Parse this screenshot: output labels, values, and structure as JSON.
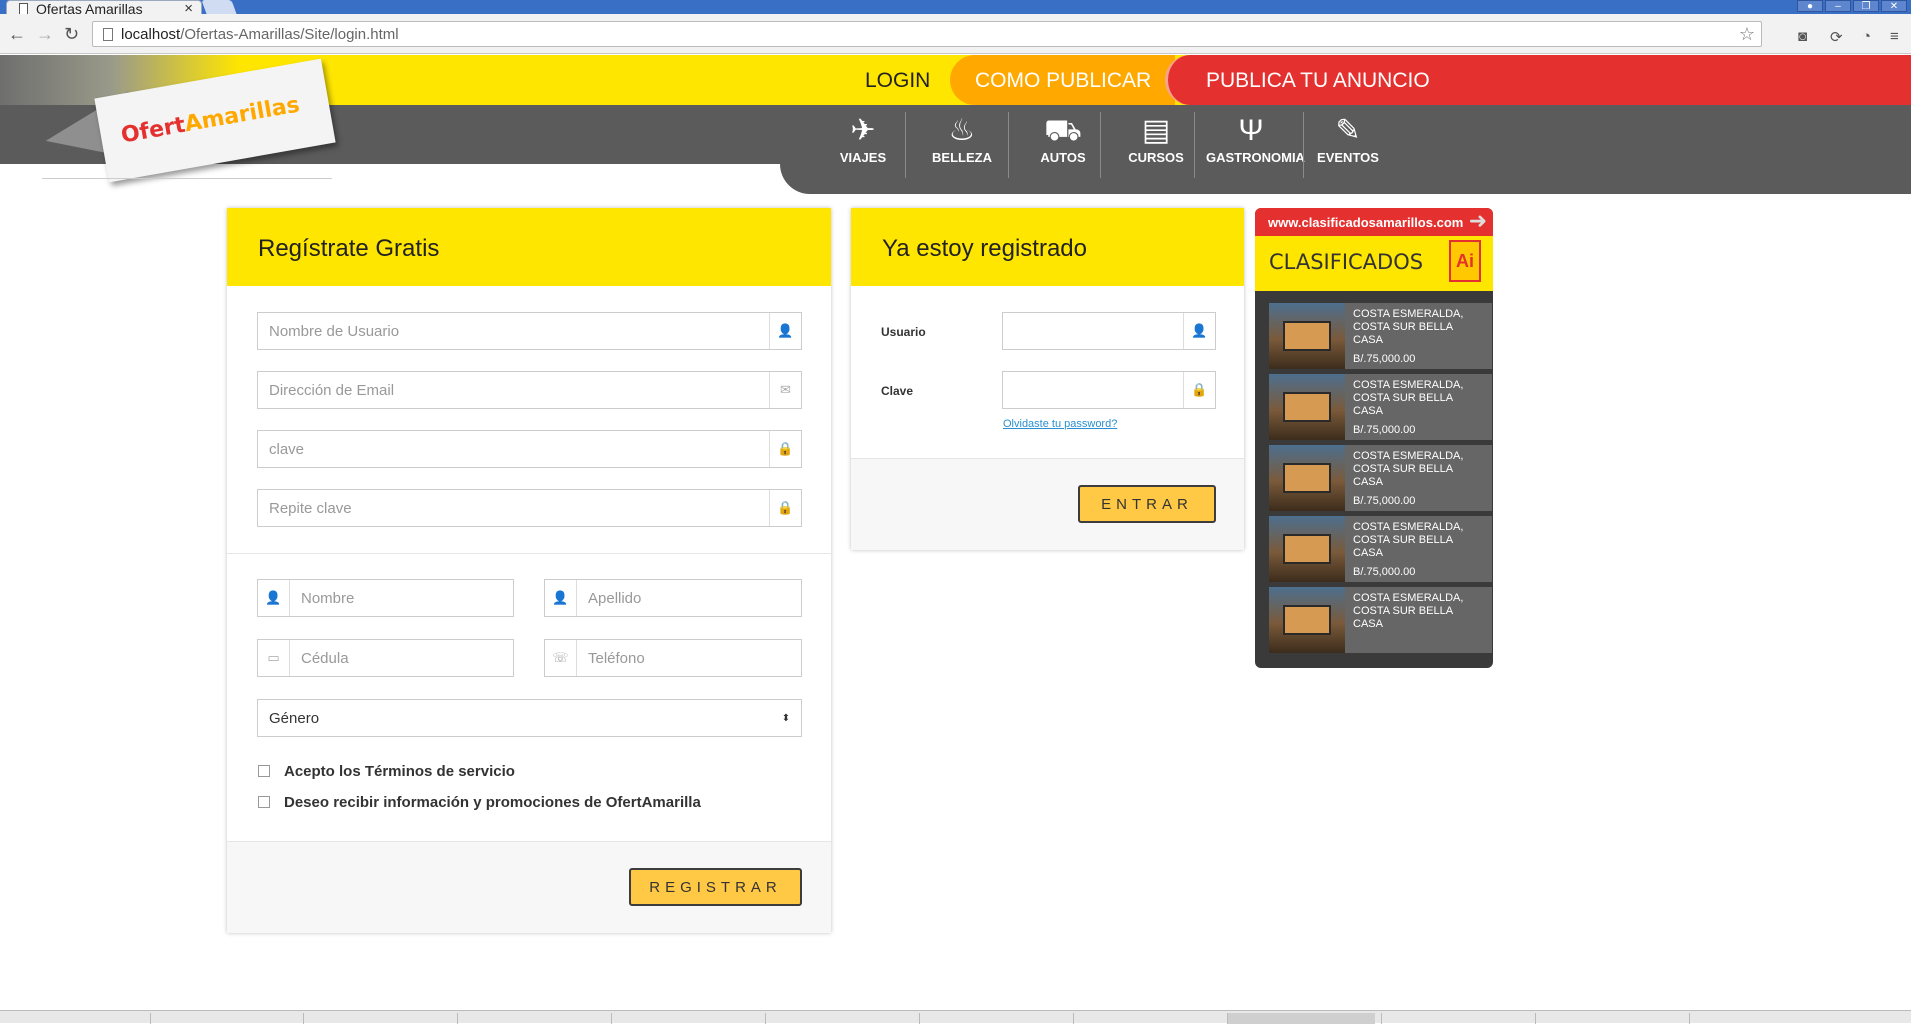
{
  "browser": {
    "tab_title": "Ofertas Amarillas",
    "url_host": "localhost",
    "url_path": "/Ofertas-Amarillas/Site/login.html"
  },
  "header": {
    "logo_text_a": "Ofert",
    "logo_text_b": "Amarillas",
    "menu": [
      "LOGIN",
      "COMO PUBLICAR",
      "PUBLICA TU ANUNCIO"
    ],
    "categories": [
      {
        "label": "VIAJES",
        "icon": "airplane-icon"
      },
      {
        "label": "BELLEZA",
        "icon": "hairdryer-icon"
      },
      {
        "label": "AUTOS",
        "icon": "car-icon"
      },
      {
        "label": "CURSOS",
        "icon": "book-icon"
      },
      {
        "label": "GASTRONOMIA",
        "icon": "cutlery-icon"
      },
      {
        "label": "EVENTOS",
        "icon": "ticket-icon"
      }
    ]
  },
  "register": {
    "title": "Regístrate Gratis",
    "username_placeholder": "Nombre de Usuario",
    "email_placeholder": "Dirección de Email",
    "password_placeholder": "clave",
    "repeat_placeholder": "Repite clave",
    "name_placeholder": "Nombre",
    "lastname_placeholder": "Apellido",
    "id_placeholder": "Cédula",
    "phone_placeholder": "Teléfono",
    "gender_value": "Género",
    "terms_label": "Acepto los Términos de servicio",
    "promo_label": "Deseo recibir información y promociones de OfertAmarilla",
    "submit_label": "REGISTRAR"
  },
  "login": {
    "title": "Ya estoy registrado",
    "user_label": "Usuario",
    "password_label": "Clave",
    "forgot_link": "Olvidaste tu password?",
    "submit_label": "ENTRAR"
  },
  "ad": {
    "url": "www.clasificadosamarillos.com",
    "title": "CLASIFICADOS",
    "items": [
      {
        "text": "COSTA ESMERALDA, COSTA SUR BELLA CASA",
        "price": "B/.75,000.00"
      },
      {
        "text": "COSTA ESMERALDA, COSTA SUR BELLA CASA",
        "price": "B/.75,000.00"
      },
      {
        "text": "COSTA ESMERALDA, COSTA SUR BELLA CASA",
        "price": "B/.75,000.00"
      },
      {
        "text": "COSTA ESMERALDA, COSTA SUR BELLA CASA",
        "price": "B/.75,000.00"
      },
      {
        "text": "COSTA ESMERALDA, COSTA SUR BELLA CASA",
        "price": ""
      }
    ]
  },
  "colors": {
    "yellow": "#ffe600",
    "orange": "#ffa800",
    "red": "#e4312f",
    "grey_band": "#5b5b5b",
    "button": "#ffc845"
  }
}
